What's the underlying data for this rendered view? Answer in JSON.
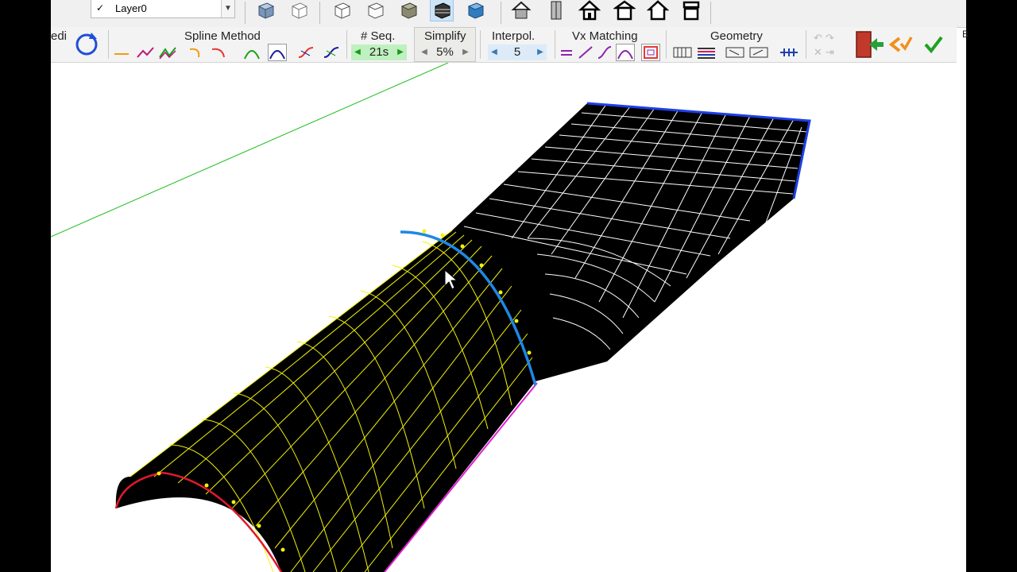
{
  "layer": {
    "name": "Layer0",
    "check": "✓"
  },
  "toolbar": {
    "left_cut_label": "edi",
    "groups": {
      "spline_method": "Spline Method",
      "seq": "# Seq.",
      "simplify": "Simplify",
      "interpol": "Interpol.",
      "vx_matching": "Vx Matching",
      "geometry": "Geometry"
    },
    "seq_value": "21s",
    "simplify_value": "5%",
    "interpol_value": "5",
    "right_cut_label": "B"
  },
  "colors": {
    "mesh_black": "#000000",
    "grid_yellow": "#f2f20c",
    "grid_white": "#ffffff",
    "edge_blue": "#1e88e5",
    "edge_red": "#e0192b",
    "edge_magenta": "#e01fd0",
    "axis_green": "#1fbf1f"
  },
  "icons": [
    "layer-check-icon",
    "dropdown-arrow-icon",
    "box-shaded-icon",
    "box-wire-icon",
    "house-icon",
    "rotate-icon",
    "exit-door-icon",
    "validate-check-icon"
  ]
}
